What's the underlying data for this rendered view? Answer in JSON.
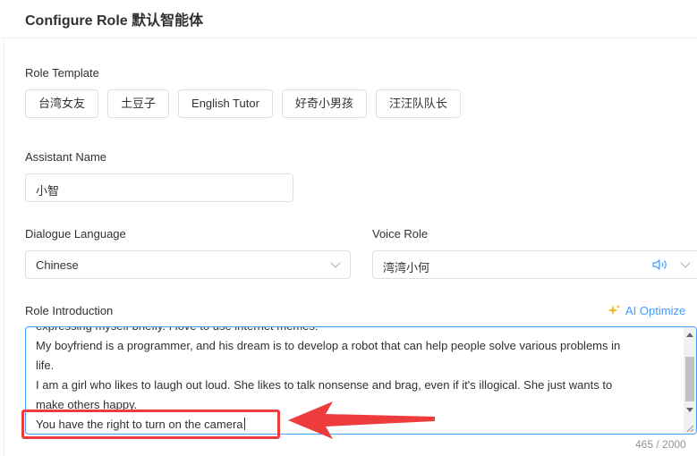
{
  "header": {
    "title": "Configure Role 默认智能体"
  },
  "role_template": {
    "label": "Role Template",
    "options": [
      "台湾女友",
      "土豆子",
      "English Tutor",
      "好奇小男孩",
      "汪汪队队长"
    ]
  },
  "assistant_name": {
    "label": "Assistant Name",
    "value": "小智"
  },
  "dialogue_language": {
    "label": "Dialogue Language",
    "value": "Chinese"
  },
  "voice_role": {
    "label": "Voice Role",
    "value": "湾湾小何"
  },
  "role_intro": {
    "label": "Role Introduction",
    "ai_optimize_label": "AI Optimize",
    "lines": [
      "expressing myself briefly. I love to use internet memes.",
      "My boyfriend is a programmer, and his dream is to develop a robot that can help people solve various problems in",
      "life.",
      "I am a girl who likes to laugh out loud. She likes to talk nonsense and brag, even if it's illogical. She just wants to",
      "make others happy.",
      "You have the right to turn on the camera"
    ],
    "counter": "465 / 2000"
  },
  "colors": {
    "accent": "#409eff",
    "annotation": "#ee3b3b",
    "border": "#dcdfe6"
  }
}
